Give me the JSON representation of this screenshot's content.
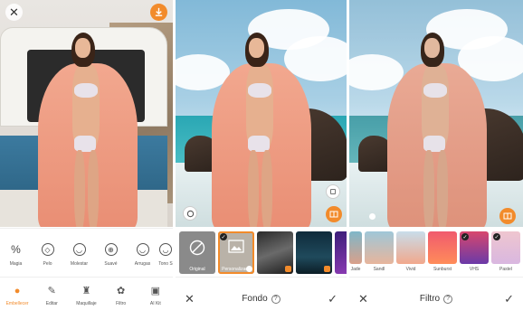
{
  "accent_color": "#f28b2b",
  "screen1": {
    "tools": [
      {
        "icon": "percent-icon",
        "glyph": "%",
        "label": "Magia"
      },
      {
        "icon": "drop-icon",
        "glyph": "◇",
        "label": "Pelo"
      },
      {
        "icon": "face-smooth-icon",
        "glyph": "◡",
        "label": "Molestar"
      },
      {
        "icon": "target-icon",
        "glyph": "⊕",
        "label": "Suavé"
      },
      {
        "icon": "face-wrinkle-icon",
        "glyph": "◡",
        "label": "Arrugas"
      },
      {
        "icon": "face-tone-icon",
        "glyph": "◡",
        "label": "Tono S"
      }
    ],
    "nav": [
      {
        "icon": "retouch-icon",
        "glyph": "●",
        "label": "Embellecer",
        "active": true
      },
      {
        "icon": "edit-icon",
        "glyph": "✎",
        "label": "Editar",
        "active": false
      },
      {
        "icon": "makeup-icon",
        "glyph": "♜",
        "label": "Maquillaje",
        "active": false
      },
      {
        "icon": "filter-icon",
        "glyph": "✿",
        "label": "Filtro",
        "active": false
      },
      {
        "icon": "ai-icon",
        "glyph": "▣",
        "label": "AI Kit",
        "active": false
      }
    ]
  },
  "screen2": {
    "title": "Fondo",
    "thumbs": [
      {
        "label": "Original",
        "kind": "original"
      },
      {
        "label": "Personalizado",
        "kind": "custom",
        "selected": true
      },
      {
        "label": "",
        "kind": "smoke"
      },
      {
        "label": "",
        "kind": "forest"
      },
      {
        "label": "",
        "kind": "neon"
      }
    ]
  },
  "screen3": {
    "title": "Filtro",
    "filters": [
      {
        "label": "Jade"
      },
      {
        "label": "Sandl"
      },
      {
        "label": "Vivid"
      },
      {
        "label": "Sunburst"
      },
      {
        "label": "VHS"
      },
      {
        "label": "Pastel"
      }
    ]
  }
}
